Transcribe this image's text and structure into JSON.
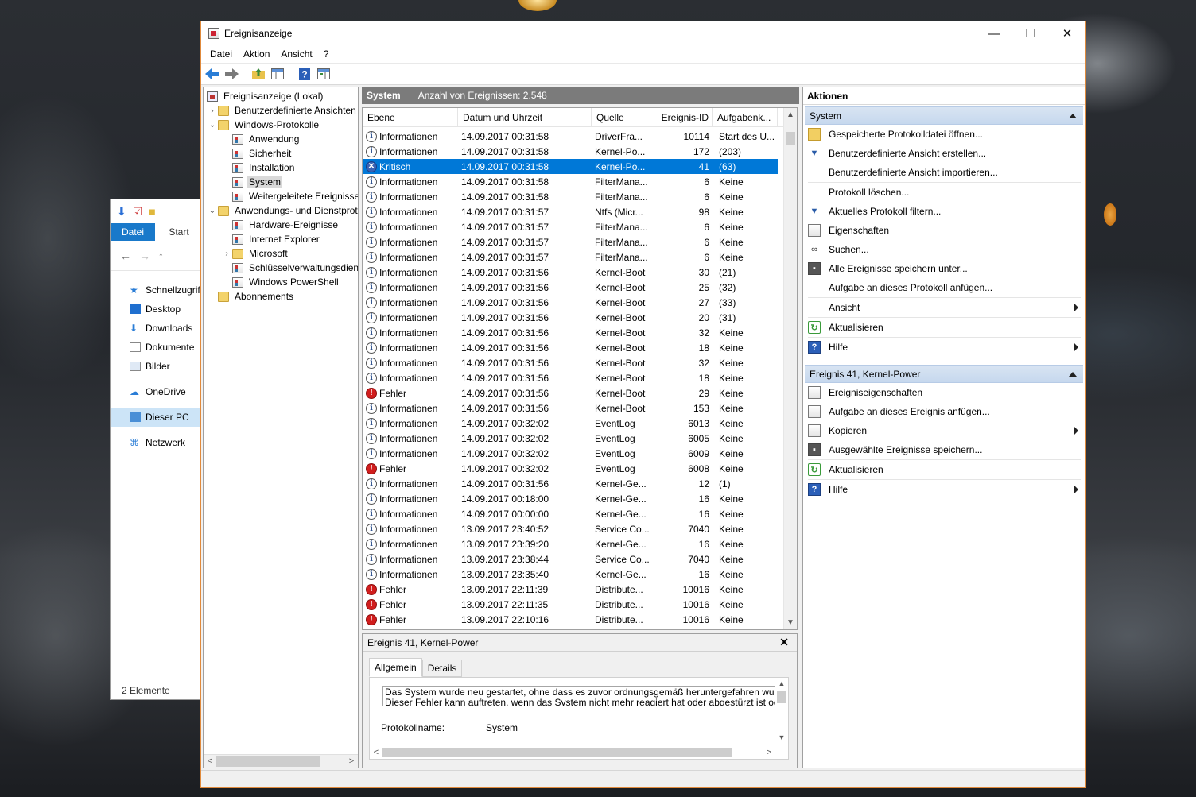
{
  "window": {
    "title": "Ereignisanzeige",
    "controls": {
      "minimize": "—",
      "maximize": "☐",
      "close": "✕"
    }
  },
  "menu": [
    "Datei",
    "Aktion",
    "Ansicht",
    "?"
  ],
  "explorer": {
    "tabs": {
      "file": "Datei",
      "start": "Start"
    },
    "nav": [
      {
        "label": "Schnellzugriff",
        "icon": "star-icon"
      },
      {
        "label": "Desktop",
        "icon": "desktop-icon"
      },
      {
        "label": "Downloads",
        "icon": "download-icon"
      },
      {
        "label": "Dokumente",
        "icon": "document-icon"
      },
      {
        "label": "Bilder",
        "icon": "pictures-icon"
      },
      {
        "label": "OneDrive",
        "icon": "cloud-icon"
      },
      {
        "label": "Dieser PC",
        "icon": "computer-icon"
      },
      {
        "label": "Netzwerk",
        "icon": "network-icon"
      }
    ],
    "status": "2 Elemente"
  },
  "tree": [
    {
      "label": "Ereignisanzeige (Lokal)",
      "level": 0,
      "expander": "",
      "icon": "root"
    },
    {
      "label": "Benutzerdefinierte Ansichten",
      "level": 1,
      "expander": ">",
      "icon": "folder"
    },
    {
      "label": "Windows-Protokolle",
      "level": 1,
      "expander": "v",
      "icon": "folder"
    },
    {
      "label": "Anwendung",
      "level": 2,
      "expander": "",
      "icon": "log"
    },
    {
      "label": "Sicherheit",
      "level": 2,
      "expander": "",
      "icon": "log"
    },
    {
      "label": "Installation",
      "level": 2,
      "expander": "",
      "icon": "log"
    },
    {
      "label": "System",
      "level": 2,
      "expander": "",
      "icon": "log",
      "selected": true
    },
    {
      "label": "Weitergeleitete Ereignisse",
      "level": 2,
      "expander": "",
      "icon": "log"
    },
    {
      "label": "Anwendungs- und Dienstprotokolle",
      "level": 1,
      "expander": "v",
      "icon": "folder"
    },
    {
      "label": "Hardware-Ereignisse",
      "level": 2,
      "expander": "",
      "icon": "log"
    },
    {
      "label": "Internet Explorer",
      "level": 2,
      "expander": "",
      "icon": "log"
    },
    {
      "label": "Microsoft",
      "level": 2,
      "expander": ">",
      "icon": "folder"
    },
    {
      "label": "Schlüsselverwaltungsdienst",
      "level": 2,
      "expander": "",
      "icon": "log"
    },
    {
      "label": "Windows PowerShell",
      "level": 2,
      "expander": "",
      "icon": "log"
    },
    {
      "label": "Abonnements",
      "level": 1,
      "expander": "",
      "icon": "folder"
    }
  ],
  "log": {
    "name": "System",
    "count_label": "Anzahl von Ereignissen: 2.548",
    "columns": [
      "Ebene",
      "Datum und Uhrzeit",
      "Quelle",
      "Ereignis-ID",
      "Aufgabenk..."
    ],
    "rows": [
      {
        "level": "Informationen",
        "type": "info",
        "date": "14.09.2017 00:31:58",
        "source": "DriverFra...",
        "id": "10114",
        "task": "Start des U..."
      },
      {
        "level": "Informationen",
        "type": "info",
        "date": "14.09.2017 00:31:58",
        "source": "Kernel-Po...",
        "id": "172",
        "task": "(203)"
      },
      {
        "level": "Kritisch",
        "type": "crit",
        "date": "14.09.2017 00:31:58",
        "source": "Kernel-Po...",
        "id": "41",
        "task": "(63)",
        "selected": true
      },
      {
        "level": "Informationen",
        "type": "info",
        "date": "14.09.2017 00:31:58",
        "source": "FilterMana...",
        "id": "6",
        "task": "Keine"
      },
      {
        "level": "Informationen",
        "type": "info",
        "date": "14.09.2017 00:31:58",
        "source": "FilterMana...",
        "id": "6",
        "task": "Keine"
      },
      {
        "level": "Informationen",
        "type": "info",
        "date": "14.09.2017 00:31:57",
        "source": "Ntfs (Micr...",
        "id": "98",
        "task": "Keine"
      },
      {
        "level": "Informationen",
        "type": "info",
        "date": "14.09.2017 00:31:57",
        "source": "FilterMana...",
        "id": "6",
        "task": "Keine"
      },
      {
        "level": "Informationen",
        "type": "info",
        "date": "14.09.2017 00:31:57",
        "source": "FilterMana...",
        "id": "6",
        "task": "Keine"
      },
      {
        "level": "Informationen",
        "type": "info",
        "date": "14.09.2017 00:31:57",
        "source": "FilterMana...",
        "id": "6",
        "task": "Keine"
      },
      {
        "level": "Informationen",
        "type": "info",
        "date": "14.09.2017 00:31:56",
        "source": "Kernel-Boot",
        "id": "30",
        "task": "(21)"
      },
      {
        "level": "Informationen",
        "type": "info",
        "date": "14.09.2017 00:31:56",
        "source": "Kernel-Boot",
        "id": "25",
        "task": "(32)"
      },
      {
        "level": "Informationen",
        "type": "info",
        "date": "14.09.2017 00:31:56",
        "source": "Kernel-Boot",
        "id": "27",
        "task": "(33)"
      },
      {
        "level": "Informationen",
        "type": "info",
        "date": "14.09.2017 00:31:56",
        "source": "Kernel-Boot",
        "id": "20",
        "task": "(31)"
      },
      {
        "level": "Informationen",
        "type": "info",
        "date": "14.09.2017 00:31:56",
        "source": "Kernel-Boot",
        "id": "32",
        "task": "Keine"
      },
      {
        "level": "Informationen",
        "type": "info",
        "date": "14.09.2017 00:31:56",
        "source": "Kernel-Boot",
        "id": "18",
        "task": "Keine"
      },
      {
        "level": "Informationen",
        "type": "info",
        "date": "14.09.2017 00:31:56",
        "source": "Kernel-Boot",
        "id": "32",
        "task": "Keine"
      },
      {
        "level": "Informationen",
        "type": "info",
        "date": "14.09.2017 00:31:56",
        "source": "Kernel-Boot",
        "id": "18",
        "task": "Keine"
      },
      {
        "level": "Fehler",
        "type": "err",
        "date": "14.09.2017 00:31:56",
        "source": "Kernel-Boot",
        "id": "29",
        "task": "Keine"
      },
      {
        "level": "Informationen",
        "type": "info",
        "date": "14.09.2017 00:31:56",
        "source": "Kernel-Boot",
        "id": "153",
        "task": "Keine"
      },
      {
        "level": "Informationen",
        "type": "info",
        "date": "14.09.2017 00:32:02",
        "source": "EventLog",
        "id": "6013",
        "task": "Keine"
      },
      {
        "level": "Informationen",
        "type": "info",
        "date": "14.09.2017 00:32:02",
        "source": "EventLog",
        "id": "6005",
        "task": "Keine"
      },
      {
        "level": "Informationen",
        "type": "info",
        "date": "14.09.2017 00:32:02",
        "source": "EventLog",
        "id": "6009",
        "task": "Keine"
      },
      {
        "level": "Fehler",
        "type": "err",
        "date": "14.09.2017 00:32:02",
        "source": "EventLog",
        "id": "6008",
        "task": "Keine"
      },
      {
        "level": "Informationen",
        "type": "info",
        "date": "14.09.2017 00:31:56",
        "source": "Kernel-Ge...",
        "id": "12",
        "task": "(1)"
      },
      {
        "level": "Informationen",
        "type": "info",
        "date": "14.09.2017 00:18:00",
        "source": "Kernel-Ge...",
        "id": "16",
        "task": "Keine"
      },
      {
        "level": "Informationen",
        "type": "info",
        "date": "14.09.2017 00:00:00",
        "source": "Kernel-Ge...",
        "id": "16",
        "task": "Keine"
      },
      {
        "level": "Informationen",
        "type": "info",
        "date": "13.09.2017 23:40:52",
        "source": "Service Co...",
        "id": "7040",
        "task": "Keine"
      },
      {
        "level": "Informationen",
        "type": "info",
        "date": "13.09.2017 23:39:20",
        "source": "Kernel-Ge...",
        "id": "16",
        "task": "Keine"
      },
      {
        "level": "Informationen",
        "type": "info",
        "date": "13.09.2017 23:38:44",
        "source": "Service Co...",
        "id": "7040",
        "task": "Keine"
      },
      {
        "level": "Informationen",
        "type": "info",
        "date": "13.09.2017 23:35:40",
        "source": "Kernel-Ge...",
        "id": "16",
        "task": "Keine"
      },
      {
        "level": "Fehler",
        "type": "err",
        "date": "13.09.2017 22:11:39",
        "source": "Distribute...",
        "id": "10016",
        "task": "Keine"
      },
      {
        "level": "Fehler",
        "type": "err",
        "date": "13.09.2017 22:11:35",
        "source": "Distribute...",
        "id": "10016",
        "task": "Keine"
      },
      {
        "level": "Fehler",
        "type": "err",
        "date": "13.09.2017 22:10:16",
        "source": "Distribute...",
        "id": "10016",
        "task": "Keine"
      }
    ]
  },
  "detail": {
    "title": "Ereignis 41, Kernel-Power",
    "tabs": [
      "Allgemein",
      "Details"
    ],
    "text_line1": "Das System wurde neu gestartet, ohne dass es zuvor ordnungsgemäß heruntergefahren wurd",
    "text_line2": "Dieser Fehler kann auftreten, wenn das System nicht mehr reagiert hat oder abgestürzt ist ode",
    "field_label": "Protokollname:",
    "field_value": "System"
  },
  "actions": {
    "header": "Aktionen",
    "section1": "System",
    "items1": [
      {
        "label": "Gespeicherte Protokolldatei öffnen...",
        "icon": "folder-open-icon",
        "cls": "i-folder",
        "glyph": ""
      },
      {
        "label": "Benutzerdefinierte Ansicht erstellen...",
        "icon": "filter-icon",
        "cls": "i-filter",
        "glyph": "▼"
      },
      {
        "label": "Benutzerdefinierte Ansicht importieren...",
        "icon": "",
        "cls": "",
        "glyph": ""
      },
      {
        "label": "Protokoll löschen...",
        "icon": "",
        "cls": "",
        "glyph": "",
        "sep_before": true
      },
      {
        "label": "Aktuelles Protokoll filtern...",
        "icon": "filter-icon",
        "cls": "i-filter",
        "glyph": "▼"
      },
      {
        "label": "Eigenschaften",
        "icon": "properties-icon",
        "cls": "i-doc",
        "glyph": ""
      },
      {
        "label": "Suchen...",
        "icon": "binoculars-icon",
        "cls": "i-find",
        "glyph": "∞"
      },
      {
        "label": "Alle Ereignisse speichern unter...",
        "icon": "save-icon",
        "cls": "i-save",
        "glyph": "▪"
      },
      {
        "label": "Aufgabe an dieses Protokoll anfügen...",
        "icon": "",
        "cls": "",
        "glyph": ""
      },
      {
        "label": "Ansicht",
        "icon": "",
        "cls": "",
        "glyph": "",
        "submenu": true,
        "sep_before": true
      },
      {
        "label": "Aktualisieren",
        "icon": "refresh-icon",
        "cls": "i-refresh",
        "glyph": "↻",
        "sep_before": true
      },
      {
        "label": "Hilfe",
        "icon": "help-icon",
        "cls": "i-help",
        "glyph": "?",
        "submenu": true,
        "sep_before": true
      }
    ],
    "section2": "Ereignis 41, Kernel-Power",
    "items2": [
      {
        "label": "Ereigniseigenschaften",
        "icon": "properties-icon",
        "cls": "i-doc",
        "glyph": ""
      },
      {
        "label": "Aufgabe an dieses Ereignis anfügen...",
        "icon": "task-icon",
        "cls": "i-doc",
        "glyph": ""
      },
      {
        "label": "Kopieren",
        "icon": "copy-icon",
        "cls": "i-doc",
        "glyph": "",
        "submenu": true
      },
      {
        "label": "Ausgewählte Ereignisse speichern...",
        "icon": "save-icon",
        "cls": "i-save",
        "glyph": "▪"
      },
      {
        "label": "Aktualisieren",
        "icon": "refresh-icon",
        "cls": "i-refresh",
        "glyph": "↻",
        "sep_before": true
      },
      {
        "label": "Hilfe",
        "icon": "help-icon",
        "cls": "i-help",
        "glyph": "?",
        "submenu": true,
        "sep_before": true
      }
    ]
  }
}
